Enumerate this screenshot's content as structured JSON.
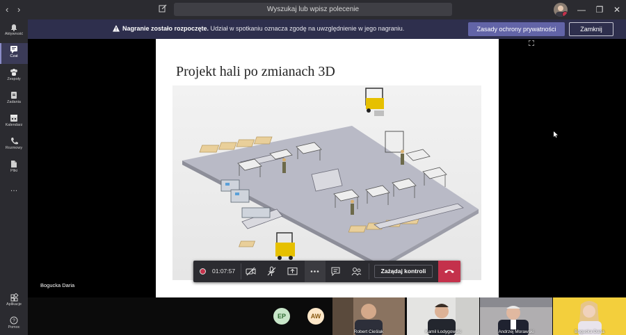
{
  "titlebar": {
    "back": "‹",
    "forward": "›",
    "search_placeholder": "Wyszukaj lub wpisz polecenie",
    "minimize": "—",
    "maximize": "❐",
    "close": "✕"
  },
  "sidebar": {
    "items": [
      {
        "label": "Aktywność",
        "icon": "bell-icon"
      },
      {
        "label": "Czat",
        "icon": "chat-icon"
      },
      {
        "label": "Zespoły",
        "icon": "teams-icon"
      },
      {
        "label": "Zadania",
        "icon": "assignments-icon"
      },
      {
        "label": "Kalendarz",
        "icon": "calendar-icon"
      },
      {
        "label": "Rozmowy",
        "icon": "phone-icon"
      },
      {
        "label": "Pliki",
        "icon": "files-icon"
      },
      {
        "label": "…",
        "icon": "more-icon"
      }
    ],
    "bottom_items": [
      {
        "label": "Aplikacje",
        "icon": "apps-icon"
      },
      {
        "label": "Pomoc",
        "icon": "help-icon"
      }
    ]
  },
  "banner": {
    "bold_text": "Nagranie zostało rozpoczęte.",
    "text": " Udział w spotkaniu oznacza zgodę na uwzględnienie w jego nagraniu.",
    "privacy_button": "Zasady ochrony prywatności",
    "close_button": "Zamknij"
  },
  "slide": {
    "title": "Projekt hali po zmianach 3D"
  },
  "presenter_name": "Bogucka Daria",
  "call_controls": {
    "recording_time": "01:07:57",
    "request_control": "Zażądaj kontroli"
  },
  "participants": [
    {
      "initials": "EP",
      "color": "#c8e6c9",
      "text_color": "#2e6b31"
    },
    {
      "initials": "AW",
      "color": "#fde7c8",
      "text_color": "#8a5a12"
    }
  ],
  "video_tiles": [
    {
      "name": "Robert Cieślak"
    },
    {
      "name": "Kamil Łodygowski"
    },
    {
      "name": "Andrzej Morawski"
    },
    {
      "name": "Bogucka Daria"
    }
  ],
  "colors": {
    "accent": "#6264a7",
    "hangup": "#c4314b",
    "banner_bg": "#2e2f4d"
  }
}
